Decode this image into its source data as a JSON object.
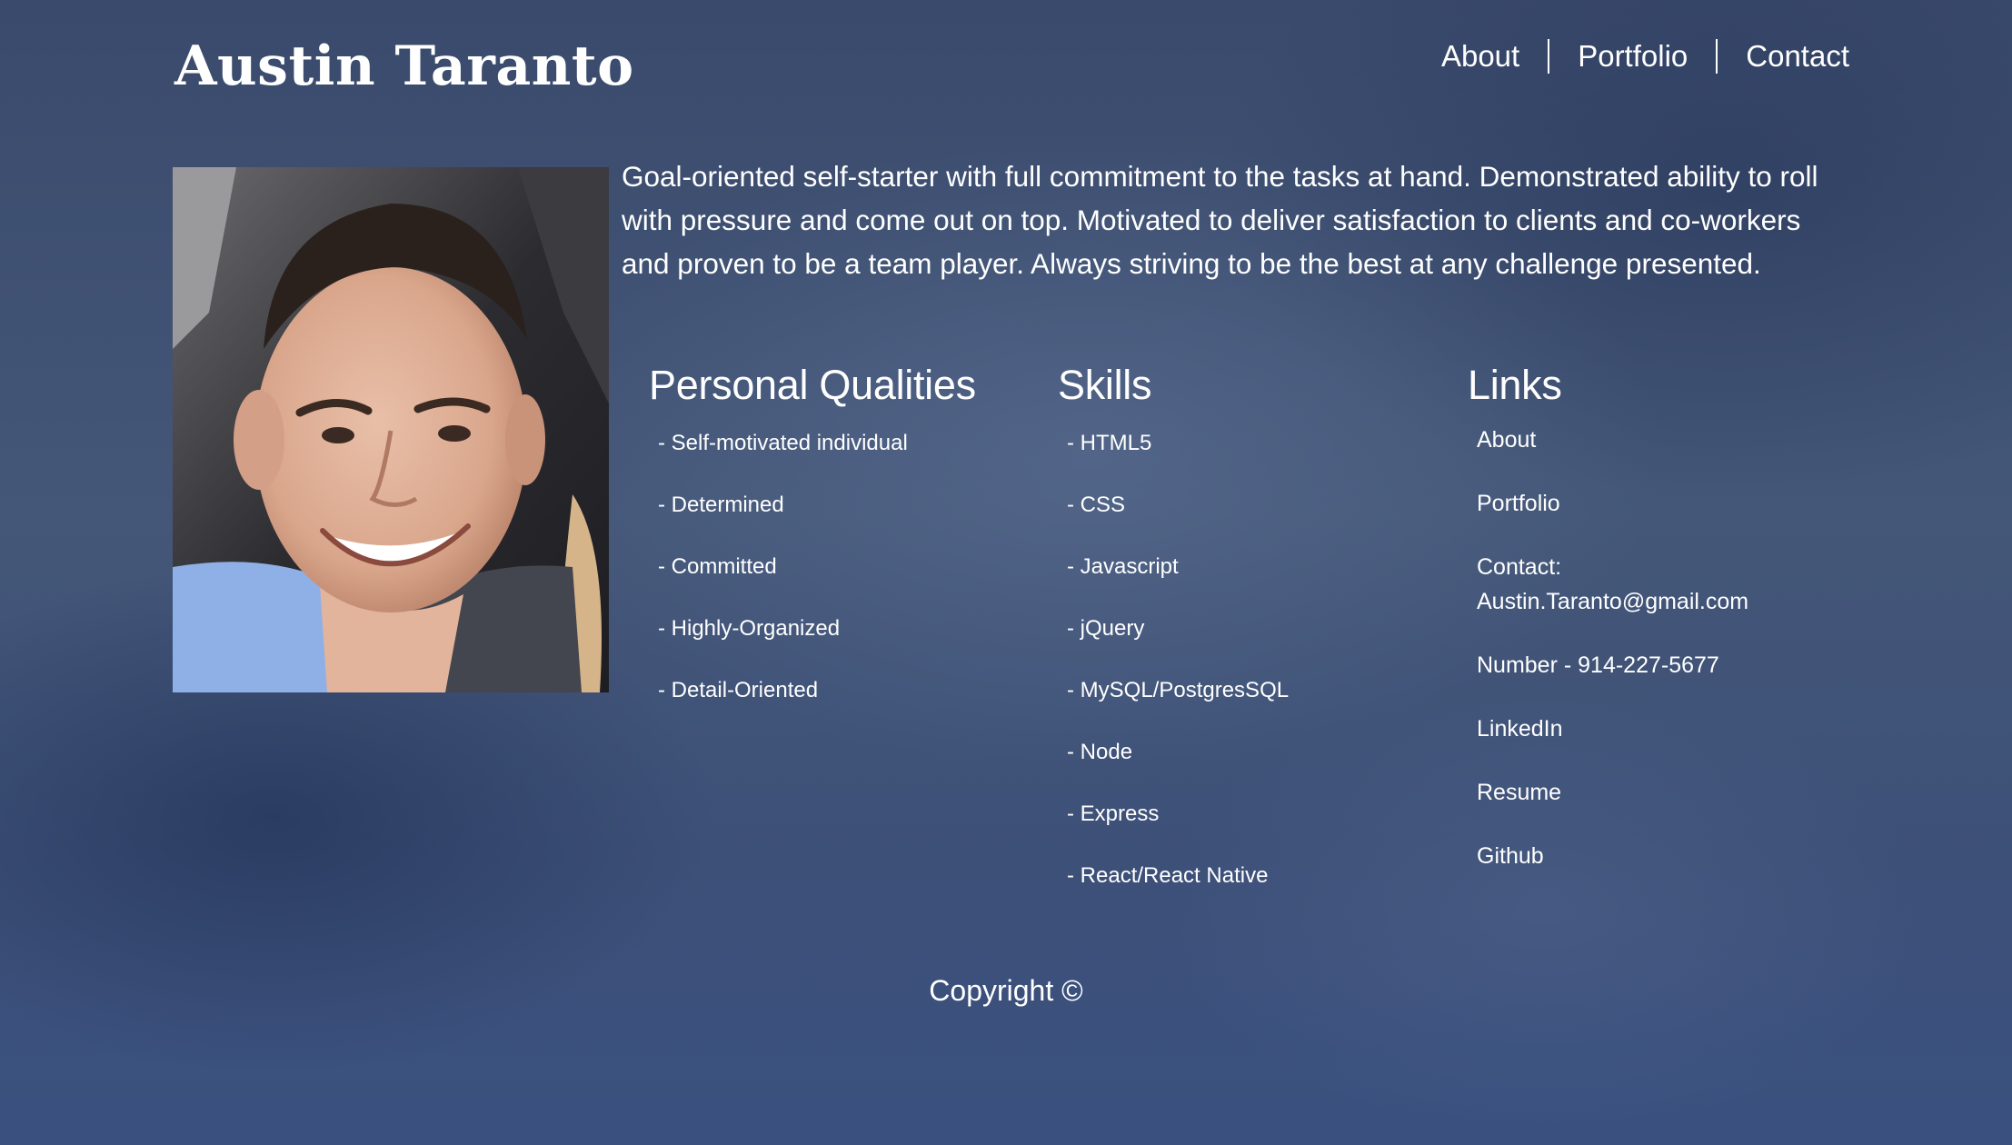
{
  "header": {
    "name": "Austin Taranto",
    "nav": [
      "About",
      "Portfolio",
      "Contact"
    ]
  },
  "bio": "Goal-oriented self-starter with full commitment to the tasks at hand. Demonstrated ability to roll with pressure and come out on top. Motivated to deliver satisfaction to clients and co-workers and proven to be a team player. Always striving to be the best at any challenge presented.",
  "qualities": {
    "title": "Personal Qualities",
    "items": [
      "- Self-motivated individual",
      "- Determined",
      "- Committed",
      "- Highly-Organized",
      "- Detail-Oriented"
    ]
  },
  "skills": {
    "title": "Skills",
    "items": [
      "- HTML5",
      "- CSS",
      "- Javascript",
      "- jQuery",
      "- MySQL/PostgresSQL",
      "- Node",
      "- Express",
      "- React/React Native"
    ]
  },
  "links": {
    "title": "Links",
    "about": "About",
    "portfolio": "Portfolio",
    "contact_label": "Contact:",
    "contact_email": "Austin.Taranto@gmail.com",
    "number": "Number - 914-227-5677",
    "linkedin": "LinkedIn",
    "resume": "Resume",
    "github": "Github"
  },
  "footer": "Copyright ©",
  "colors": {
    "text": "#ffffff",
    "background": "#3f5276"
  }
}
